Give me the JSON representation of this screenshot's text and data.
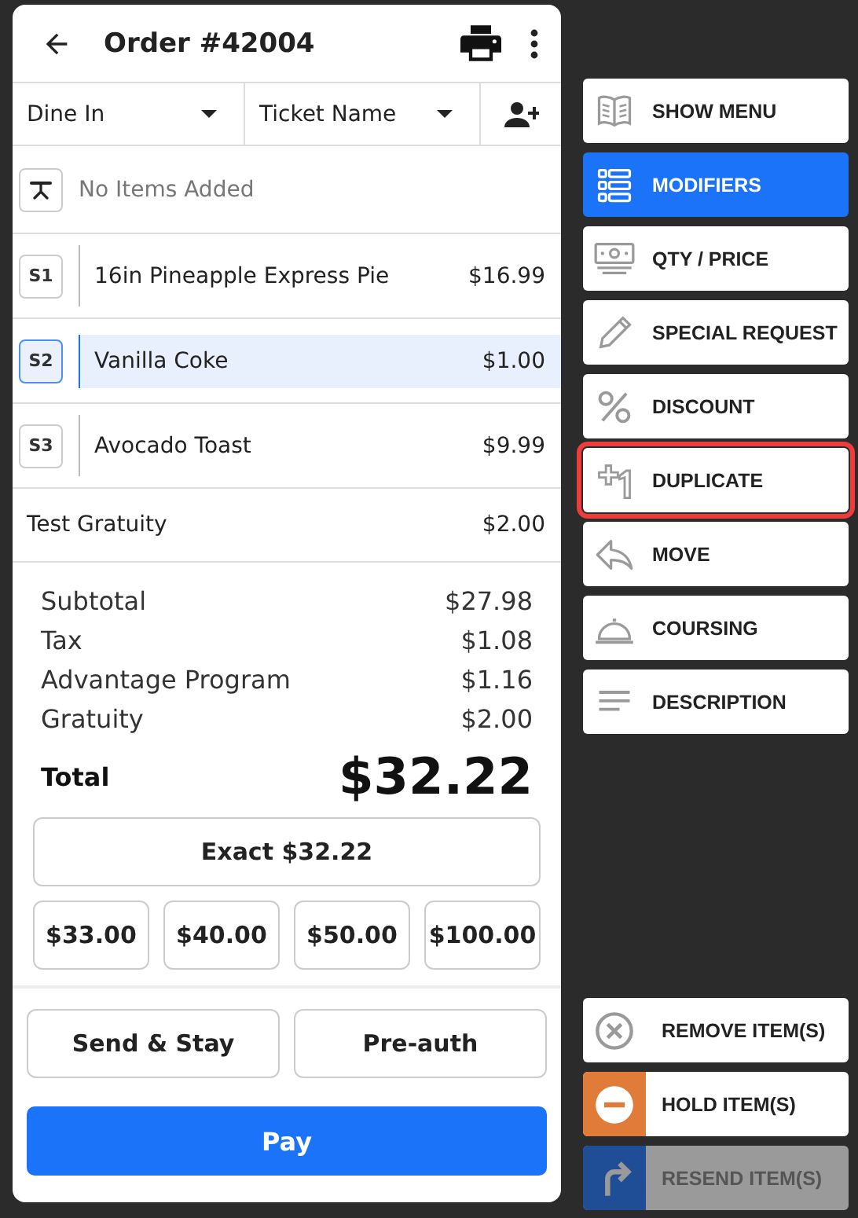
{
  "order": {
    "title": "Order #42004"
  },
  "selectors": [
    {
      "label": "Dine In"
    },
    {
      "label": "Ticket Name"
    }
  ],
  "empty_seat": {
    "text": "No Items Added"
  },
  "items": [
    {
      "seat": "S1",
      "name": "16in Pineapple Express Pie",
      "price": "$16.99",
      "selected": false
    },
    {
      "seat": "S2",
      "name": "Vanilla Coke",
      "price": "$1.00",
      "selected": true
    },
    {
      "seat": "S3",
      "name": "Avocado Toast",
      "price": "$9.99",
      "selected": false
    }
  ],
  "gratuity_line": {
    "label": "Test Gratuity",
    "amount": "$2.00"
  },
  "totals": [
    {
      "label": "Subtotal",
      "amount": "$27.98"
    },
    {
      "label": "Tax",
      "amount": "$1.08"
    },
    {
      "label": "Advantage Program",
      "amount": "$1.16"
    },
    {
      "label": "Gratuity",
      "amount": "$2.00"
    }
  ],
  "total": {
    "label": "Total",
    "amount": "$32.22"
  },
  "exact_button": "Exact $32.22",
  "quick_amounts": [
    "$33.00",
    "$40.00",
    "$50.00",
    "$100.00"
  ],
  "secondary_buttons": [
    "Send & Stay",
    "Pre-auth"
  ],
  "pay_button": "Pay",
  "actions": [
    {
      "label": "SHOW MENU",
      "selected": false,
      "highlighted": false
    },
    {
      "label": "MODIFIERS",
      "selected": true,
      "highlighted": false
    },
    {
      "label": "QTY / PRICE",
      "selected": false,
      "highlighted": false
    },
    {
      "label": "SPECIAL REQUEST",
      "selected": false,
      "highlighted": false
    },
    {
      "label": "DISCOUNT",
      "selected": false,
      "highlighted": false
    },
    {
      "label": "DUPLICATE",
      "selected": false,
      "highlighted": true
    },
    {
      "label": "MOVE",
      "selected": false,
      "highlighted": false
    },
    {
      "label": "COURSING",
      "selected": false,
      "highlighted": false
    },
    {
      "label": "DESCRIPTION",
      "selected": false,
      "highlighted": false
    }
  ],
  "item_actions": [
    {
      "kind": "remove",
      "label": "REMOVE ITEM(S)",
      "disabled": false
    },
    {
      "kind": "hold",
      "label": "HOLD ITEM(S)",
      "disabled": false
    },
    {
      "kind": "resend",
      "label": "RESEND ITEM(S)",
      "disabled": true
    }
  ]
}
